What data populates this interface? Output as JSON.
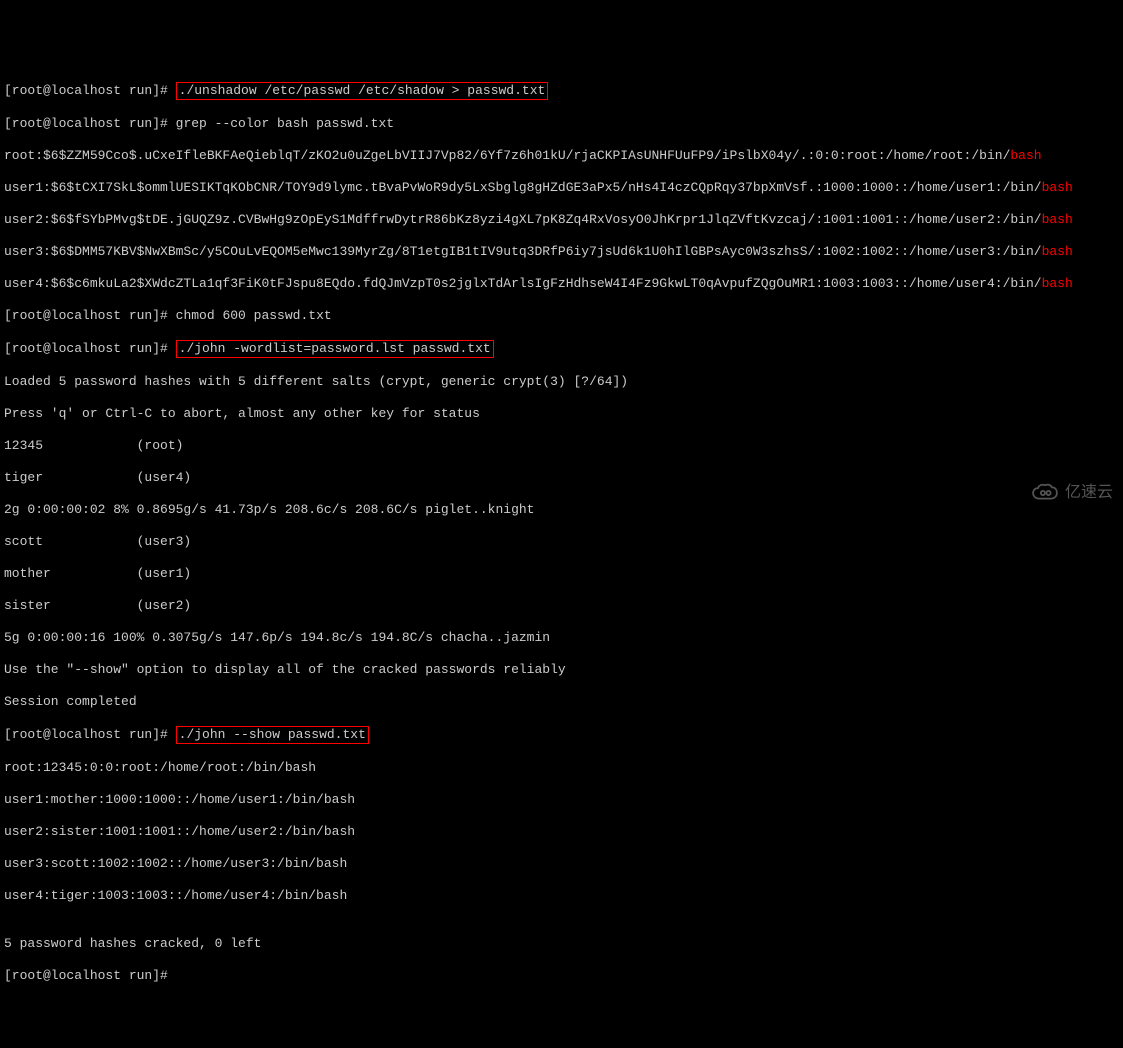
{
  "prompt": "[root@localhost run]#",
  "cmd1": "./unshadow /etc/passwd /etc/shadow > passwd.txt",
  "cmd2": "grep --color bash passwd.txt",
  "hash_lines": [
    {
      "pre": "root:$6$ZZM59Cco$.uCxeIfleBKFAeQieblqT/zKO2u0uZgeLbVIIJ7Vp82/6Yf7z6h01kU/rjaCKPIAsUNHFUuFP9/iPslbX04y/.:0:0:root:/home/root:/bin/",
      "hl": "bash"
    },
    {
      "pre": "user1:$6$tCXI7SkL$ommlUESIKTqKObCNR/TOY9d9lymc.tBvaPvWoR9dy5LxSbglg8gHZdGE3aPx5/nHs4I4czCQpRqy37bpXmVsf.:1000:1000::/home/user1:/bin/",
      "hl": "bash"
    },
    {
      "pre": "user2:$6$fSYbPMvg$tDE.jGUQZ9z.CVBwHg9zOpEyS1MdffrwDytrR86bKz8yzi4gXL7pK8Zq4RxVosyO0JhKrpr1JlqZVftKvzcaj/:1001:1001::/home/user2:/bin/",
      "hl": "bash"
    },
    {
      "pre": "user3:$6$DMM57KBV$NwXBmSc/y5COuLvEQOM5eMwc139MyrZg/8T1etgIB1tIV9utq3DRfP6iy7jsUd6k1U0hIlGBPsAyc0W3szhsS/:1002:1002::/home/user3:/bin/",
      "hl": "bash"
    },
    {
      "pre": "user4:$6$c6mkuLa2$XWdcZTLa1qf3FiK0tFJspu8EQdo.fdQJmVzpT0s2jglxTdArlsIgFzHdhseW4I4Fz9GkwLT0qAvpufZQgOuMR1:1003:1003::/home/user4:/bin/",
      "hl": "bash"
    }
  ],
  "cmd3": "chmod 600 passwd.txt",
  "cmd4": "./john -wordlist=password.lst passwd.txt",
  "john_output": [
    "Loaded 5 password hashes with 5 different salts (crypt, generic crypt(3) [?/64])",
    "Press 'q' or Ctrl-C to abort, almost any other key for status",
    "12345            (root)",
    "tiger            (user4)",
    "2g 0:00:00:02 8% 0.8695g/s 41.73p/s 208.6c/s 208.6C/s piglet..knight",
    "scott            (user3)",
    "mother           (user1)",
    "sister           (user2)",
    "5g 0:00:00:16 100% 0.3075g/s 147.6p/s 194.8c/s 194.8C/s chacha..jazmin",
    "Use the \"--show\" option to display all of the cracked passwords reliably",
    "Session completed"
  ],
  "cmd5": "./john --show passwd.txt",
  "show_output": [
    "root:12345:0:0:root:/home/root:/bin/bash",
    "user1:mother:1000:1000::/home/user1:/bin/bash",
    "user2:sister:1001:1001::/home/user2:/bin/bash",
    "user3:scott:1002:1002::/home/user3:/bin/bash",
    "user4:tiger:1003:1003::/home/user4:/bin/bash",
    "",
    "5 password hashes cracked, 0 left"
  ],
  "watermark": "亿速云"
}
